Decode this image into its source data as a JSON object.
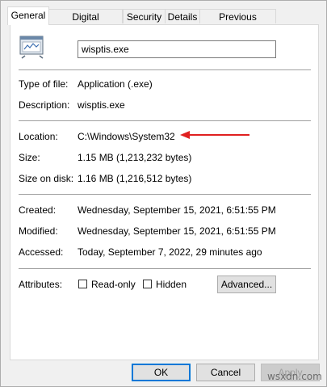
{
  "tabs": [
    "General",
    "Digital Signatures",
    "Security",
    "Details",
    "Previous Versions"
  ],
  "file_icon": "application-window-icon",
  "filename": "wisptis.exe",
  "fields": {
    "type_label": "Type of file:",
    "type_value": "Application (.exe)",
    "description_label": "Description:",
    "description_value": "wisptis.exe",
    "location_label": "Location:",
    "location_value": "C:\\Windows\\System32",
    "size_label": "Size:",
    "size_value": "1.15 MB (1,213,232 bytes)",
    "size_on_disk_label": "Size on disk:",
    "size_on_disk_value": "1.16 MB (1,216,512 bytes)",
    "created_label": "Created:",
    "created_value": "Wednesday, September 15, 2021, 6:51:55 PM",
    "modified_label": "Modified:",
    "modified_value": "Wednesday, September 15, 2021, 6:51:55 PM",
    "accessed_label": "Accessed:",
    "accessed_value": "Today, September 7, 2022, 29 minutes ago"
  },
  "attributes": {
    "label": "Attributes:",
    "readonly_label": "Read-only",
    "hidden_label": "Hidden",
    "advanced_label": "Advanced..."
  },
  "buttons": {
    "ok": "OK",
    "cancel": "Cancel",
    "apply": "Apply"
  },
  "watermark": "wsxdn.com",
  "colors": {
    "annotation_arrow": "#e02020",
    "default_button_border": "#0078d7"
  }
}
